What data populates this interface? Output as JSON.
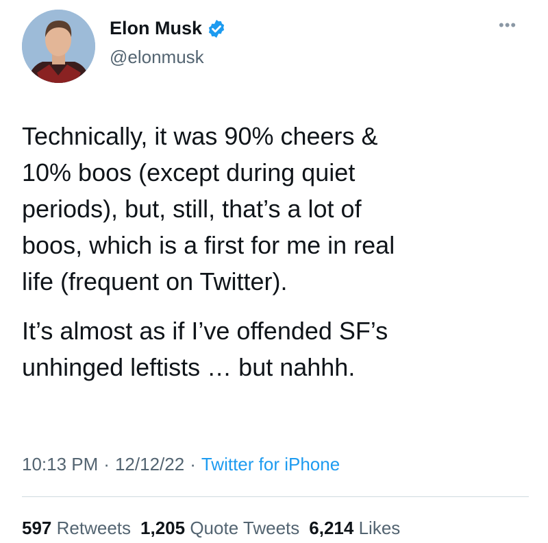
{
  "author": {
    "name": "Elon Musk",
    "handle": "@elonmusk",
    "verified_color": "#1d9bf0"
  },
  "tweet": {
    "paragraphs": [
      "Technically, it was 90% cheers &\n10% boos (except during quiet\nperiods), but, still, that’s a lot of\nboos, which is a first for me in real\nlife (frequent on Twitter).",
      "It’s almost as if I’ve offended SF’s\nunhinged leftists … but nahhh."
    ]
  },
  "meta": {
    "time": "10:13 PM",
    "separator": "·",
    "date": "12/12/22",
    "source": "Twitter for iPhone"
  },
  "stats": {
    "retweets_count": "597",
    "retweets_label": "Retweets",
    "quotes_count": "1,205",
    "quotes_label": "Quote Tweets",
    "likes_count": "6,214",
    "likes_label": "Likes"
  },
  "icons": {
    "more": "more-options-icon",
    "verified": "verified-badge-icon"
  },
  "colors": {
    "text": "#0f1419",
    "secondary": "#536471",
    "link": "#1d9bf0",
    "divider": "#cfd9de"
  }
}
